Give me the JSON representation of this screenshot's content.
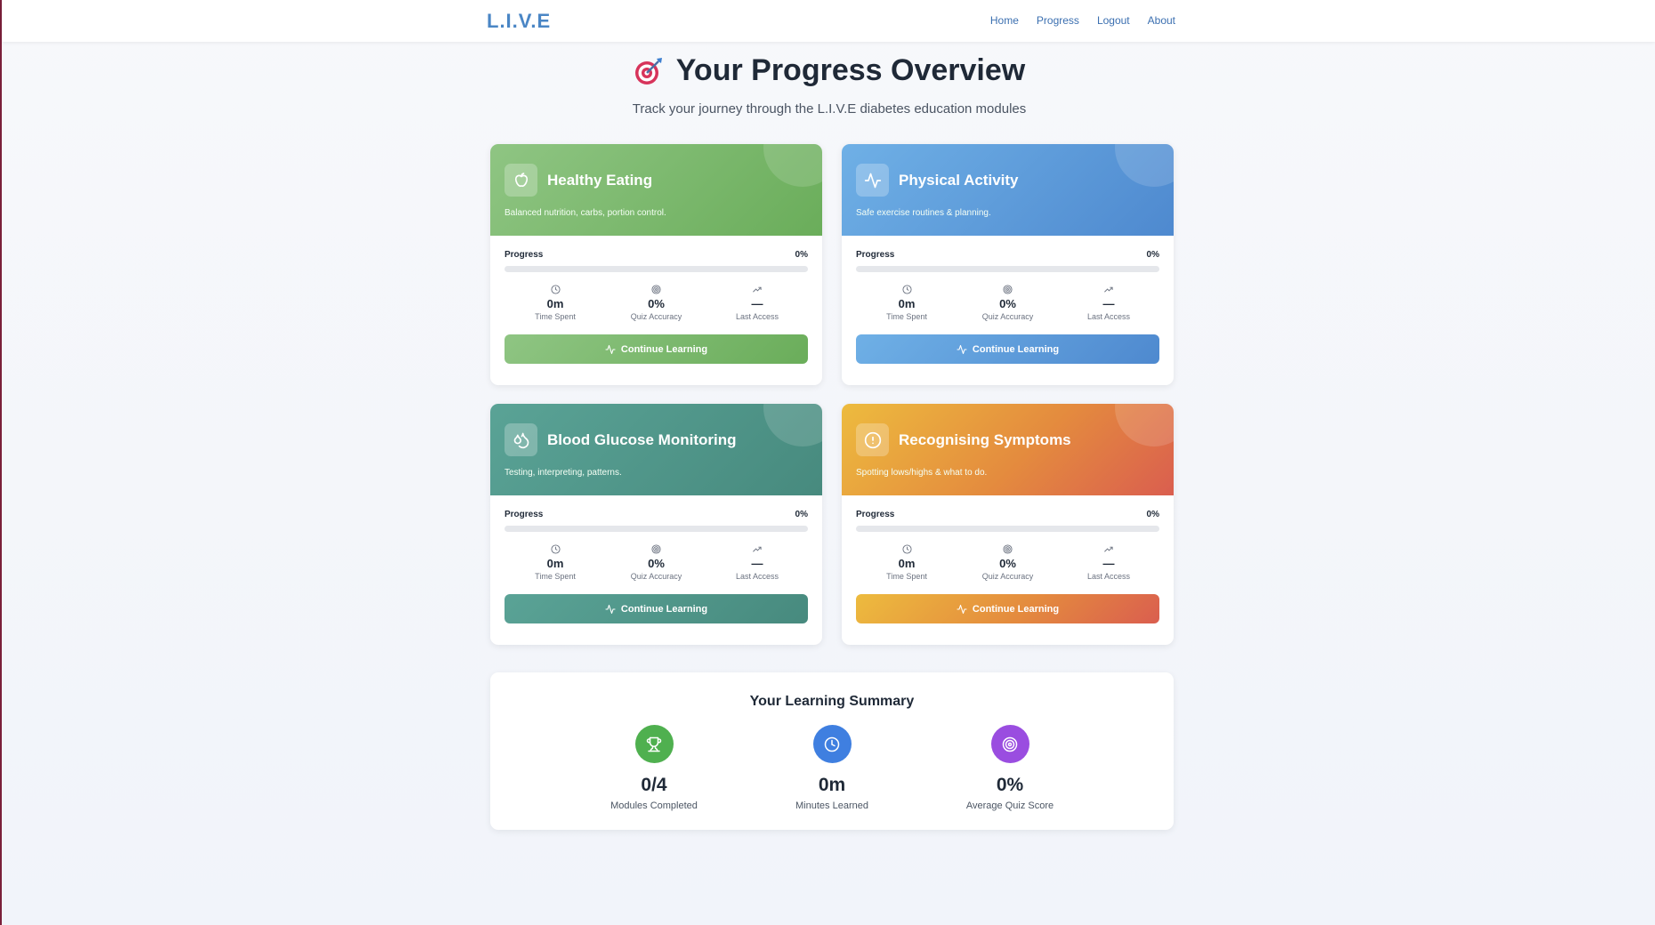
{
  "nav": {
    "brand": "L.I.V.E",
    "links": [
      "Home",
      "Progress",
      "Logout",
      "About"
    ]
  },
  "header": {
    "icon": "target-dart-icon",
    "title": "Your Progress Overview",
    "subtitle": "Track your journey through the L.I.V.E diabetes education modules"
  },
  "modules": [
    {
      "title": "Healthy Eating",
      "description": "Balanced nutrition, carbs, portion control.",
      "icon": "apple-icon",
      "theme": "green",
      "progress_label": "Progress",
      "progress_value": "0%",
      "progress_fraction": 0,
      "stats": [
        {
          "icon": "clock-icon",
          "value": "0m",
          "label": "Time Spent"
        },
        {
          "icon": "target-icon",
          "value": "0%",
          "label": "Quiz Accuracy"
        },
        {
          "icon": "trending-up-icon",
          "value": "—",
          "label": "Last Access"
        }
      ],
      "button": "Continue Learning"
    },
    {
      "title": "Physical Activity",
      "description": "Safe exercise routines & planning.",
      "icon": "activity-icon",
      "theme": "blue",
      "progress_label": "Progress",
      "progress_value": "0%",
      "progress_fraction": 0,
      "stats": [
        {
          "icon": "clock-icon",
          "value": "0m",
          "label": "Time Spent"
        },
        {
          "icon": "target-icon",
          "value": "0%",
          "label": "Quiz Accuracy"
        },
        {
          "icon": "trending-up-icon",
          "value": "—",
          "label": "Last Access"
        }
      ],
      "button": "Continue Learning"
    },
    {
      "title": "Blood Glucose Monitoring",
      "description": "Testing, interpreting, patterns.",
      "icon": "droplets-icon",
      "theme": "teal",
      "progress_label": "Progress",
      "progress_value": "0%",
      "progress_fraction": 0,
      "stats": [
        {
          "icon": "clock-icon",
          "value": "0m",
          "label": "Time Spent"
        },
        {
          "icon": "target-icon",
          "value": "0%",
          "label": "Quiz Accuracy"
        },
        {
          "icon": "trending-up-icon",
          "value": "—",
          "label": "Last Access"
        }
      ],
      "button": "Continue Learning"
    },
    {
      "title": "Recognising Symptoms",
      "description": "Spotting lows/highs & what to do.",
      "icon": "alert-circle-icon",
      "theme": "orange",
      "progress_label": "Progress",
      "progress_value": "0%",
      "progress_fraction": 0,
      "stats": [
        {
          "icon": "clock-icon",
          "value": "0m",
          "label": "Time Spent"
        },
        {
          "icon": "target-icon",
          "value": "0%",
          "label": "Quiz Accuracy"
        },
        {
          "icon": "trending-up-icon",
          "value": "—",
          "label": "Last Access"
        }
      ],
      "button": "Continue Learning"
    }
  ],
  "summary": {
    "title": "Your Learning Summary",
    "items": [
      {
        "icon": "trophy-icon",
        "value": "0/4",
        "label": "Modules Completed",
        "color": "#4fb04f"
      },
      {
        "icon": "clock-icon",
        "value": "0m",
        "label": "Minutes Learned",
        "color": "#3f7fe0"
      },
      {
        "icon": "target-icon",
        "value": "0%",
        "label": "Average Quiz Score",
        "color": "#9a4de0"
      }
    ]
  },
  "colors": {
    "brand": "#4a86c5",
    "green": "#6aad5a",
    "blue": "#4e89cf",
    "teal": "#478a7e",
    "orange": "#e48b3e"
  }
}
